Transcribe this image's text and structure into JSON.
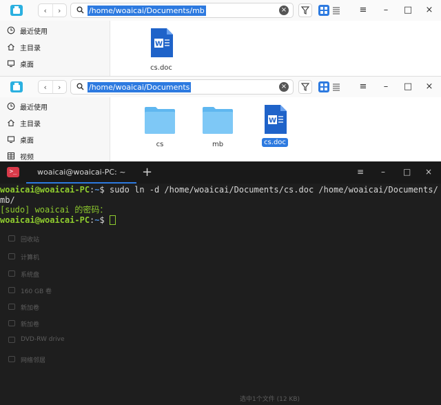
{
  "window_back": {
    "address_path": "/home/woaicai/Documents/mb",
    "sidebar": [
      {
        "label": "最近使用",
        "icon": "clock-icon"
      },
      {
        "label": "主目录",
        "icon": "home-icon"
      },
      {
        "label": "桌面",
        "icon": "desktop-icon"
      }
    ],
    "files": [
      {
        "name": "cs.doc",
        "type": "word-doc"
      }
    ]
  },
  "window_front": {
    "address_path": "/home/woaicai/Documents",
    "sidebar": [
      {
        "label": "最近使用",
        "icon": "clock-icon"
      },
      {
        "label": "主目录",
        "icon": "home-icon"
      },
      {
        "label": "桌面",
        "icon": "desktop-icon"
      },
      {
        "label": "视频",
        "icon": "video-icon"
      }
    ],
    "files": [
      {
        "name": "cs",
        "type": "folder"
      },
      {
        "name": "mb",
        "type": "folder"
      },
      {
        "name": "cs.doc",
        "type": "word-doc",
        "selected": true
      }
    ]
  },
  "terminal": {
    "tab_title": "woaicai@woaicai-PC: ~",
    "lines": {
      "l1_user": "woaicai@woaicai-PC",
      "l1_sep": ":",
      "l1_tilde": "~",
      "l1_cmd": "$ sudo ln -d /home/woaicai/Documents/cs.doc /home/woaicai/Documents/",
      "l2": "mb/",
      "l3": "[sudo] woaicai 的密码：",
      "l4_user": "woaicai@woaicai-PC",
      "l4_sep": ":",
      "l4_tilde": "~",
      "l4_dollar": "$ "
    }
  },
  "background_sidebar_ghost": [
    "回收站",
    "计算机",
    "系统盘",
    "160 GB 卷",
    "新加卷",
    "新加卷",
    "DVD-RW drive",
    "网络邻居"
  ],
  "status_ghost": "选中1个文件 (12 KB)",
  "colors": {
    "accent": "#2d7ae0",
    "terminal_bg": "#1e1e1e",
    "prompt_green": "#8fcc2e",
    "prompt_blue": "#4f8fdd"
  }
}
